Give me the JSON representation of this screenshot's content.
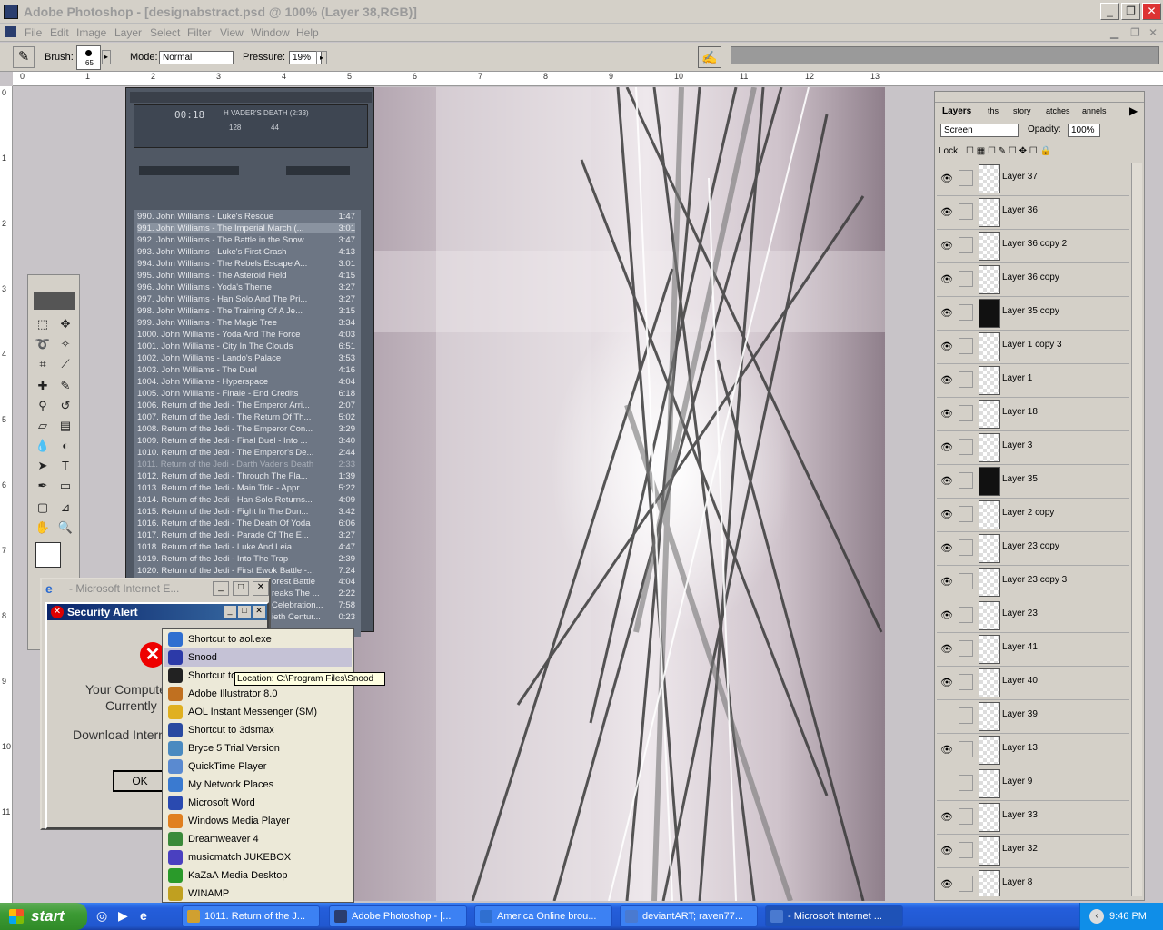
{
  "app": {
    "title": "Adobe Photoshop - [designabstract.psd @ 100% (Layer 38,RGB)]",
    "menu": [
      "File",
      "Edit",
      "Image",
      "Layer",
      "Select",
      "Filter",
      "View",
      "Window",
      "Help"
    ]
  },
  "options": {
    "brush_label": "Brush:",
    "brush_size": "65",
    "mode_label": "Mode:",
    "mode_value": "Normal",
    "pressure_label": "Pressure:",
    "pressure_value": "19%"
  },
  "ruler": {
    "h": [
      "0",
      "1",
      "2",
      "3",
      "4",
      "5",
      "6",
      "7",
      "8",
      "9",
      "10",
      "11",
      "12",
      "13"
    ],
    "v": [
      "0",
      "1",
      "2",
      "3",
      "4",
      "5",
      "6",
      "7",
      "8",
      "9",
      "10",
      "11"
    ]
  },
  "winamp": {
    "now_playing": "H VADER'S DEATH (2:33)",
    "time": "00:18",
    "bitrate": "128",
    "khz": "44",
    "playlist": [
      {
        "n": "990. John Williams - Luke's Rescue",
        "t": "1:47"
      },
      {
        "n": "991. John Williams - The Imperial March (...",
        "t": "3:01"
      },
      {
        "n": "992. John Williams - The Battle in the Snow",
        "t": "3:47"
      },
      {
        "n": "993. John Williams - Luke's First Crash",
        "t": "4:13"
      },
      {
        "n": "994. John Williams - The Rebels Escape A...",
        "t": "3:01"
      },
      {
        "n": "995. John Williams - The Asteroid Field",
        "t": "4:15"
      },
      {
        "n": "996. John Williams - Yoda's Theme",
        "t": "3:27"
      },
      {
        "n": "997. John Williams - Han Solo And The Pri...",
        "t": "3:27"
      },
      {
        "n": "998. John Williams - The Training Of A Je...",
        "t": "3:15"
      },
      {
        "n": "999. John Williams - The Magic Tree",
        "t": "3:34"
      },
      {
        "n": "1000. John Williams - Yoda And The Force",
        "t": "4:03"
      },
      {
        "n": "1001. John Williams - City In The Clouds",
        "t": "6:51"
      },
      {
        "n": "1002. John Williams - Lando's Palace",
        "t": "3:53"
      },
      {
        "n": "1003. John Williams - The Duel",
        "t": "4:16"
      },
      {
        "n": "1004. John Williams - Hyperspace",
        "t": "4:04"
      },
      {
        "n": "1005. John Williams - Finale - End Credits",
        "t": "6:18"
      },
      {
        "n": "1006. Return of the Jedi - The Emperor Arri...",
        "t": "2:07"
      },
      {
        "n": "1007. Return of the Jedi - The Return Of Th...",
        "t": "5:02"
      },
      {
        "n": "1008. Return of the Jedi - The Emperor Con...",
        "t": "3:29"
      },
      {
        "n": "1009. Return of the Jedi - Final Duel - Into ...",
        "t": "3:40"
      },
      {
        "n": "1010. Return of the Jedi - The Emperor's De...",
        "t": "2:44"
      },
      {
        "n": "1011. Return of the Jedi - Darth Vader's Death",
        "t": "2:33"
      },
      {
        "n": "1012. Return of the Jedi - Through The Fla...",
        "t": "1:39"
      },
      {
        "n": "1013. Return of the Jedi - Main Title - Appr...",
        "t": "5:22"
      },
      {
        "n": "1014. Return of the Jedi - Han Solo Returns...",
        "t": "4:09"
      },
      {
        "n": "1015. Return of the Jedi - Fight In The Dun...",
        "t": "3:42"
      },
      {
        "n": "1016. Return of the Jedi - The Death Of Yoda",
        "t": "6:06"
      },
      {
        "n": "1017. Return of the Jedi - Parade Of The E...",
        "t": "3:27"
      },
      {
        "n": "1018. Return of the Jedi - Luke And Leia",
        "t": "4:47"
      },
      {
        "n": "1019. Return of the Jedi - Into The Trap",
        "t": "2:39"
      },
      {
        "n": "1020. Return of the Jedi - First Ewok Battle -...",
        "t": "7:24"
      }
    ],
    "playlist_tail": [
      {
        "n": "orest Battle",
        "t": "4:04"
      },
      {
        "n": "reaks The ...",
        "t": "2:22"
      },
      {
        "n": "Celebration...",
        "t": "7:58"
      },
      {
        "n": "ieth Centur...",
        "t": "0:23"
      }
    ]
  },
  "layers_panel": {
    "tabs": [
      "Layers",
      "ths",
      "story",
      "atches",
      "annels"
    ],
    "blend_mode": "Screen",
    "opacity_label": "Opacity:",
    "opacity_value": "100%",
    "lock_label": "Lock:",
    "layers": [
      {
        "name": "Layer 37",
        "visible": true
      },
      {
        "name": "Layer 36",
        "visible": true
      },
      {
        "name": "Layer 36 copy 2",
        "visible": true
      },
      {
        "name": "Layer 36 copy",
        "visible": true
      },
      {
        "name": "Layer 35 copy",
        "visible": true
      },
      {
        "name": "Layer 1 copy 3",
        "visible": true
      },
      {
        "name": "Layer 1",
        "visible": true
      },
      {
        "name": "Layer 18",
        "visible": true
      },
      {
        "name": "Layer 3",
        "visible": true
      },
      {
        "name": "Layer 35",
        "visible": true
      },
      {
        "name": "Layer 2 copy",
        "visible": true
      },
      {
        "name": "Layer 23 copy",
        "visible": true
      },
      {
        "name": "Layer 23 copy 3",
        "visible": true
      },
      {
        "name": "Layer 23",
        "visible": true
      },
      {
        "name": "Layer 41",
        "visible": true
      },
      {
        "name": "Layer 40",
        "visible": true
      },
      {
        "name": "Layer 39",
        "visible": false
      },
      {
        "name": "Layer 13",
        "visible": true
      },
      {
        "name": "Layer 9",
        "visible": false
      },
      {
        "name": "Layer 33",
        "visible": true
      },
      {
        "name": "Layer 32",
        "visible": true
      },
      {
        "name": "Layer 8",
        "visible": true
      }
    ]
  },
  "ie_window": {
    "title": "- Microsoft Internet E..."
  },
  "security_alert": {
    "title": "Security Alert",
    "line1": "Your Compute",
    "line2": "Currently",
    "line3": "Download Intern",
    "ok": "OK"
  },
  "start_menu": {
    "items": [
      {
        "label": "Shortcut to aol.exe",
        "color": "#2f6fd0"
      },
      {
        "label": "Snood",
        "color": "#2c3aa8"
      },
      {
        "label": "Shortcut to",
        "color": "#222"
      },
      {
        "label": "Adobe Illustrator 8.0",
        "color": "#c07020"
      },
      {
        "label": "AOL Instant Messenger (SM)",
        "color": "#e0b020"
      },
      {
        "label": "Shortcut to 3dsmax",
        "color": "#2a4aa0"
      },
      {
        "label": "Bryce 5 Trial Version",
        "color": "#4a8ac0"
      },
      {
        "label": "QuickTime Player",
        "color": "#5a8ad0"
      },
      {
        "label": "My Network Places",
        "color": "#3a7ad0"
      },
      {
        "label": "Microsoft Word",
        "color": "#2a4ab0"
      },
      {
        "label": "Windows Media Player",
        "color": "#e08020"
      },
      {
        "label": "Dreamweaver 4",
        "color": "#3a8a3a"
      },
      {
        "label": "musicmatch JUKEBOX",
        "color": "#4a40c0"
      },
      {
        "label": "KaZaA Media Desktop",
        "color": "#2a9a2a"
      },
      {
        "label": "WINAMP",
        "color": "#c0a020"
      }
    ],
    "tooltip": "Location: C:\\Program Files\\Snood"
  },
  "taskbar": {
    "start": "start",
    "tasks": [
      {
        "label": "1011. Return of the J...",
        "color": "#d0a030"
      },
      {
        "label": "Adobe Photoshop - [...",
        "color": "#2a3d6e"
      },
      {
        "label": "America  Online brou...",
        "color": "#2f6fd0"
      },
      {
        "label": "deviantART; raven77...",
        "color": "#4a7ad0"
      },
      {
        "label": "- Microsoft Internet ...",
        "color": "#4a7ad0"
      }
    ],
    "clock": "9:46 PM"
  }
}
